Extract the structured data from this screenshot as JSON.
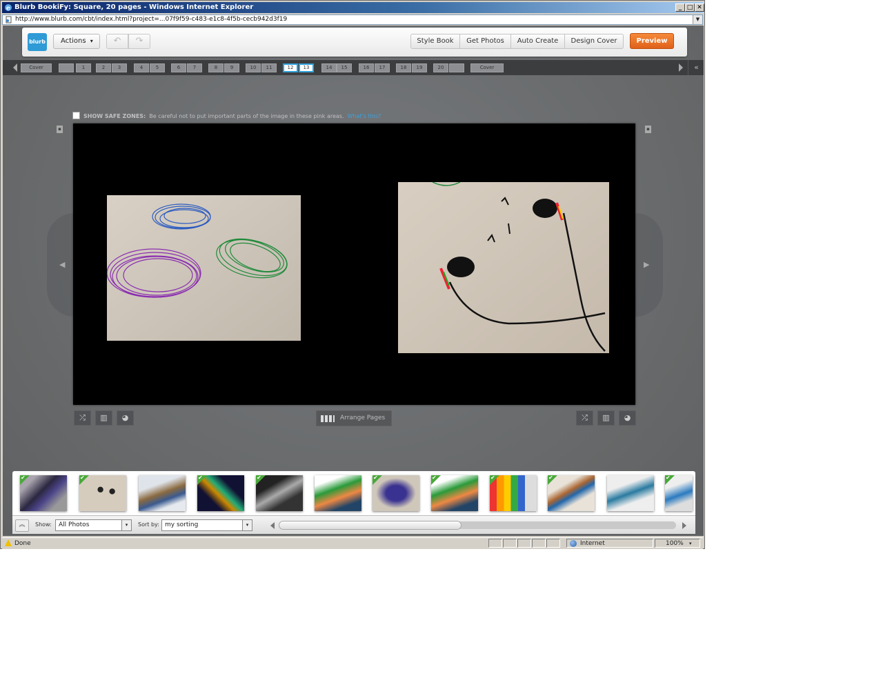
{
  "window": {
    "title": "Blurb BookiFy: Square, 20 pages - Windows Internet Explorer",
    "url": "http://www.blurb.com/cbt/index.html?project=...07f9f59-c483-e1c8-4f5b-cecb942d3f19",
    "minimize": "_",
    "maximize": "□",
    "close": "✕"
  },
  "toolbar": {
    "logo": "blurb",
    "actions_label": "Actions",
    "actions_caret": "▾",
    "undo": "↶",
    "redo": "↷",
    "style_book": "Style Book",
    "get_photos": "Get Photos",
    "auto_create": "Auto Create",
    "design_cover": "Design Cover",
    "preview": "Preview"
  },
  "pages": {
    "front_cover": "Cover",
    "back_cover": "Cover",
    "numbers": [
      "",
      "1",
      "2",
      "3",
      "4",
      "5",
      "6",
      "7",
      "8",
      "9",
      "10",
      "11",
      "12",
      "13",
      "14",
      "15",
      "16",
      "17",
      "18",
      "19",
      "20",
      ""
    ],
    "selected": [
      "12",
      "13"
    ],
    "collapse": "«"
  },
  "editor": {
    "safe_zones_label": "SHOW SAFE ZONES:",
    "safe_zones_text": "Be careful not to put important parts of the image in these pink areas.",
    "safe_zones_link": "What's this?",
    "arrange_pages": "Arrange Pages",
    "prev": "◀",
    "next": "▶",
    "page_icon": "▪"
  },
  "tray": {
    "show_label": "Show:",
    "show_value": "All Photos",
    "sort_label": "Sort by:",
    "sort_value": "my sorting",
    "dropdown_caret": "▾",
    "up_button": "︽",
    "checkmark": "✔"
  },
  "statusbar": {
    "status": "Done",
    "zone": "Internet",
    "zoom": "100%",
    "zoom_caret": "▾"
  },
  "icons": {
    "shuffle": "⤮",
    "layout": "▥",
    "palette": "◕"
  }
}
